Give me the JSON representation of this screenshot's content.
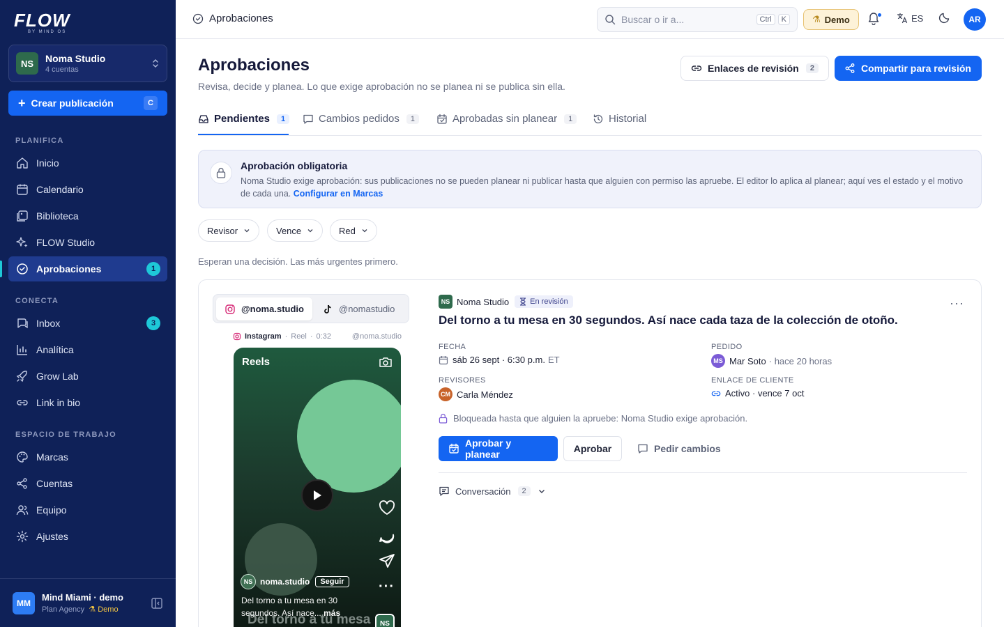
{
  "sidebar": {
    "logo": "FLOW",
    "logo_sub": "BY MIND OS",
    "org": {
      "initials": "NS",
      "name": "Noma Studio",
      "sub": "4 cuentas"
    },
    "create_label": "Crear publicación",
    "create_shortcut": "C",
    "sections": {
      "plan": "PLANIFICA",
      "connect": "CONECTA",
      "workspace": "ESPACIO DE TRABAJO"
    },
    "items": [
      {
        "label": "Inicio",
        "icon": "home-icon"
      },
      {
        "label": "Calendario",
        "icon": "calendar-icon"
      },
      {
        "label": "Biblioteca",
        "icon": "library-icon"
      },
      {
        "label": "FLOW Studio",
        "icon": "sparkles-icon"
      },
      {
        "label": "Aprobaciones",
        "icon": "check-circle-icon",
        "badge": "1"
      },
      {
        "label": "Inbox",
        "icon": "inbox-icon",
        "badge": "3"
      },
      {
        "label": "Analítica",
        "icon": "chart-icon"
      },
      {
        "label": "Grow Lab",
        "icon": "rocket-icon"
      },
      {
        "label": "Link in bio",
        "icon": "link-icon"
      },
      {
        "label": "Marcas",
        "icon": "palette-icon"
      },
      {
        "label": "Cuentas",
        "icon": "share-icon"
      },
      {
        "label": "Equipo",
        "icon": "users-icon"
      },
      {
        "label": "Ajustes",
        "icon": "gear-icon"
      }
    ],
    "footer": {
      "initials": "MM",
      "name": "Mind Miami · demo",
      "plan": "Plan Agency",
      "demo": "Demo"
    }
  },
  "topbar": {
    "breadcrumb": "Aprobaciones",
    "search_placeholder": "Buscar o ir a...",
    "kbd_ctrl": "Ctrl",
    "kbd_k": "K",
    "demo_label": "Demo",
    "lang": "ES",
    "user_initials": "AR"
  },
  "header": {
    "title": "Aprobaciones",
    "subtitle": "Revisa, decide y planea. Lo que exige aprobación no se planea ni se publica sin ella.",
    "review_links_label": "Enlaces de revisión",
    "review_links_count": "2",
    "share_label": "Compartir para revisión"
  },
  "tabs": [
    {
      "label": "Pendientes",
      "count": "1"
    },
    {
      "label": "Cambios pedidos",
      "count": "1"
    },
    {
      "label": "Aprobadas sin planear",
      "count": "1"
    },
    {
      "label": "Historial"
    }
  ],
  "notice": {
    "title": "Aprobación obligatoria",
    "text": "Noma Studio exige aprobación: sus publicaciones no se pueden planear ni publicar hasta que alguien con permiso las apruebe. El editor lo aplica al planear; aquí ves el estado y el motivo de cada una.",
    "link": "Configurar en Marcas"
  },
  "filters": [
    "Revisor",
    "Vence",
    "Red"
  ],
  "wait_text": "Esperan una decisión. Las más urgentes primero.",
  "post": {
    "accounts": [
      "@noma.studio",
      "@nomastudio"
    ],
    "preview": {
      "platform": "Instagram",
      "format": "Reel",
      "duration": "0:32",
      "handle": "@noma.studio",
      "reels_label": "Reels",
      "user": "noma.studio",
      "user_initials": "NS",
      "follow": "Seguir",
      "caption": "Del torno a tu mesa en 30 segundos. Así nace...",
      "more": "más",
      "overlay": "Del torno a tu mesa"
    },
    "brand": "Noma Studio",
    "brand_initials": "NS",
    "status": "En revisión",
    "title": "Del torno a tu mesa en 30 segundos. Así nace cada taza de la colección de otoño.",
    "date_label": "FECHA",
    "date_value": "sáb 26 sept · 6:30 p.m.",
    "date_tz": "ET",
    "requested_label": "PEDIDO",
    "requested_by": "Mar Soto",
    "requested_initials": "MS",
    "requested_when": "· hace 20 horas",
    "reviewers_label": "REVISORES",
    "reviewer": "Carla Méndez",
    "reviewer_initials": "CM",
    "client_link_label": "ENLACE DE CLIENTE",
    "client_link_value": "Activo · vence 7 oct",
    "locked_text": "Bloqueada hasta que alguien la apruebe: Noma Studio exige aprobación.",
    "approve_plan": "Aprobar y planear",
    "approve": "Aprobar",
    "request_changes": "Pedir cambios",
    "conversation": "Conversación",
    "conversation_count": "2"
  }
}
